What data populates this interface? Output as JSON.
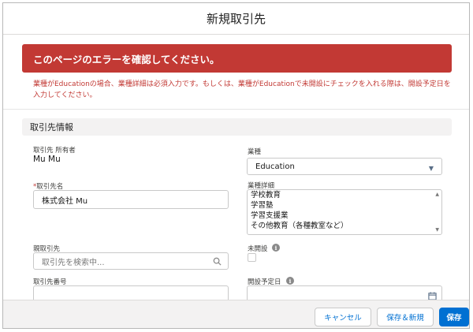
{
  "modal": {
    "title": "新規取引先"
  },
  "error": {
    "banner": "このページのエラーを確認してください。",
    "detail": "業種がEducationの場合、業種詳細は必須入力です。もしくは、業種がEducationで未開設にチェックを入れる際は、開設予定日を入力してください。"
  },
  "section": {
    "title": "取引先情報"
  },
  "fields": {
    "owner": {
      "label": "取引先 所有者",
      "value": "Mu Mu"
    },
    "industry": {
      "label": "業種",
      "value": "Education"
    },
    "account_name": {
      "required_mark": "*",
      "label": "取引先名",
      "value": "株式会社 Mu"
    },
    "industry_detail": {
      "label": "業種詳細",
      "options": [
        "学校教育",
        "学習塾",
        "学習支援業",
        "その他教育（各種教室など）"
      ]
    },
    "parent_account": {
      "label": "親取引先",
      "placeholder": "取引先を検索中..."
    },
    "not_opened": {
      "label": "未開設",
      "checked": false
    },
    "account_number": {
      "label": "取引先番号",
      "value": ""
    },
    "opening_date": {
      "label": "開設予定日",
      "value": ""
    }
  },
  "footer": {
    "cancel_label": "キャンセル",
    "save_new_label": "保存＆新規",
    "save_label": "保存"
  },
  "icons": {
    "search": "search-icon",
    "info": "info-icon",
    "calendar": "calendar-icon",
    "dropdown": "chevron-down-icon"
  },
  "colors": {
    "error": "#c23934",
    "brand": "#0070d2",
    "section_bg": "#f3f2f2"
  }
}
